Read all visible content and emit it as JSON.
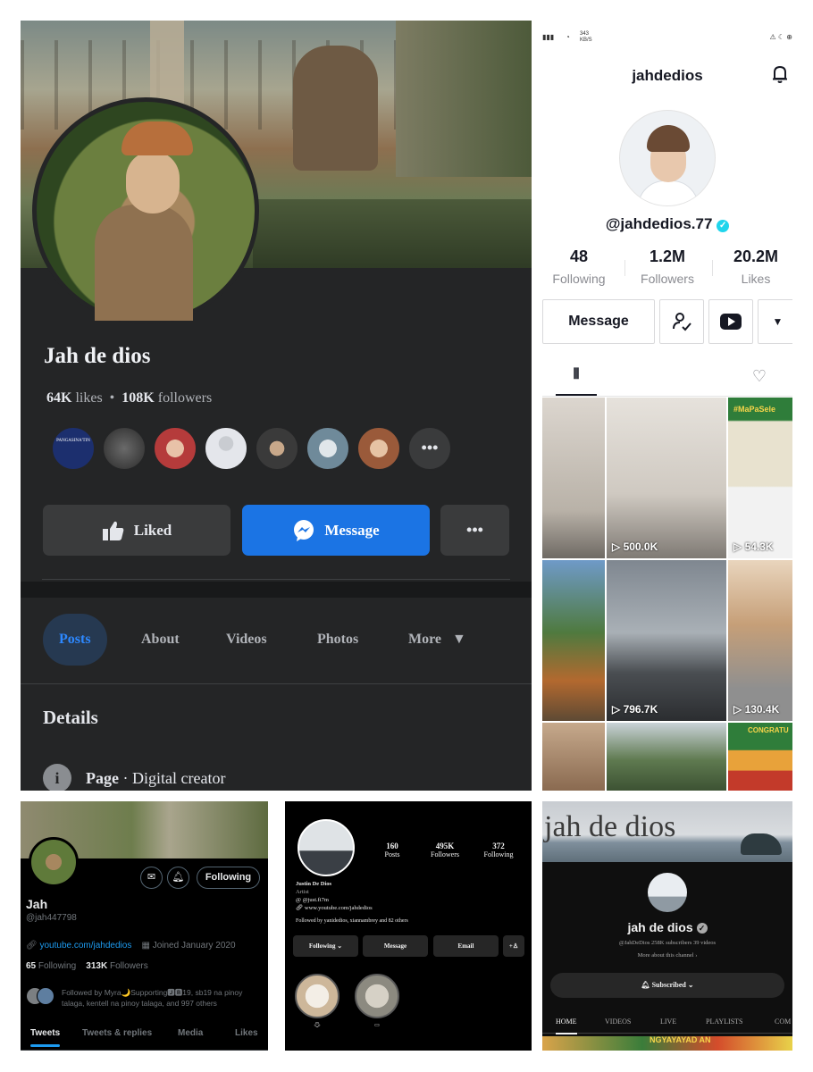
{
  "facebook": {
    "name": "Jah de dios",
    "likes_count": "64K",
    "likes_label": "likes",
    "followers_count": "108K",
    "followers_label": "followers",
    "friend_badge_text": "PANGASINA'TIN",
    "more_friends": "•••",
    "liked_label": "Liked",
    "message_label": "Message",
    "more_actions": "•••",
    "tabs": [
      "Posts",
      "About",
      "Videos",
      "Photos",
      "More"
    ],
    "details_title": "Details",
    "page_label": "Page",
    "page_category": "Digital creator",
    "accent_color": "#1b74e4"
  },
  "tiktok": {
    "status_speed": "343 KB/S",
    "title": "jahdedios",
    "handle": "@jahdedios.77",
    "stats": [
      {
        "value": "48",
        "label": "Following"
      },
      {
        "value": "1.2M",
        "label": "Followers"
      },
      {
        "value": "20.2M",
        "label": "Likes"
      }
    ],
    "message_label": "Message",
    "videos": [
      {
        "views": "500.0K"
      },
      {
        "views": "54.3K"
      },
      {
        "views": "796.7K"
      },
      {
        "views": "130.4K"
      }
    ],
    "thumb_text": "#MaPaSele",
    "thumb_text2": "CONGRATU",
    "verified_color": "#20d5ec"
  },
  "twitter": {
    "name": "Jah",
    "handle": "@jah447798",
    "link": "youtube.com/jahdedios",
    "joined": "Joined January 2020",
    "following_count": "65",
    "following_label": "Following",
    "followers_count": "313K",
    "followers_label": "Followers",
    "followed_by": "Followed by Myra🌙Supporting🅹🅱19, sb19 na pinoy talaga, kentell na pinoy talaga, and 997 others",
    "following_button": "Following",
    "tabs": [
      "Tweets",
      "Tweets & replies",
      "Media",
      "Likes"
    ],
    "accent_color": "#1d9bf0"
  },
  "instagram": {
    "stats": [
      {
        "value": "160",
        "label": "Posts"
      },
      {
        "value": "495K",
        "label": "Followers"
      },
      {
        "value": "372",
        "label": "Following"
      }
    ],
    "full_name": "Justin De Dios",
    "category": "Artist",
    "threads_handle": "@just.fi7m",
    "link": "www.youtube.com/jahdedios",
    "followed_by": "Followed by yanidedios, xiannambrey and 82 others",
    "buttons": [
      "Following",
      "Message",
      "Email"
    ]
  },
  "youtube": {
    "banner_title": "jah de dios",
    "channel_name": "jah de dios",
    "meta": "@JahDeDios  258K subscribers  39 videos",
    "more_about": "More about this channel",
    "subscribed_label": "Subscribed",
    "tabs": [
      "HOME",
      "VIDEOS",
      "LIVE",
      "PLAYLISTS",
      "COM"
    ],
    "strip_text": "NGYAYAYAD AN"
  }
}
